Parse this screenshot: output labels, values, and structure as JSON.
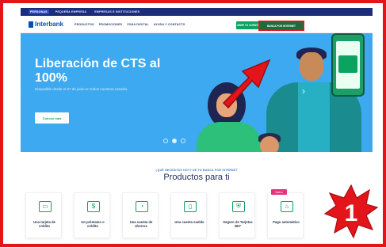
{
  "topbar": {
    "items": [
      "PERSONAS",
      "PEQUEÑA EMPRESA",
      "EMPRESAS E INSTITUCIONES"
    ]
  },
  "nav": {
    "brand": "Interbank",
    "links": [
      "PRODUCTOS",
      "PROMOCIONES",
      "ZONA DIGITAL",
      "AYUDA Y CONTACTO"
    ],
    "open_account_button": "ABRE TU CUENTA",
    "online_banking_button": "BANCA POR INTERNET"
  },
  "hero": {
    "title": "Liberación de CTS al 100%",
    "subtitle": "Disponible desde el 07 de junio en todos nuestros canales.",
    "cta": "Conoce más",
    "prev_arrow": "‹",
    "next_arrow": "›",
    "slide_count": 3,
    "active_slide": 2
  },
  "products": {
    "kicker": "¿QUÉ NECESITAS HOY? DE TU BANCA POR INTERNET",
    "title": "Productos para ti",
    "cards": [
      {
        "label": "Una tarjeta de crédito",
        "icon": "credit-card-icon",
        "glyph": "▭"
      },
      {
        "label": "Un préstamo o crédito",
        "icon": "money-bag-icon",
        "glyph": "$"
      },
      {
        "label": "Una cuenta de ahorros",
        "icon": "piggy-bank-icon",
        "glyph": "◔"
      },
      {
        "label": "Una cuenta sueldo",
        "icon": "mobile-pay-icon",
        "glyph": "▯"
      },
      {
        "label": "Seguro de Tarjetas 360°",
        "icon": "shield-card-icon",
        "glyph": "⛨"
      },
      {
        "label": "Pago automático",
        "icon": "house-icon",
        "glyph": "⌂",
        "badge": "Nuevo"
      }
    ]
  },
  "annotation": {
    "step_number": "1"
  },
  "colors": {
    "brand_blue": "#0a4fb0",
    "hero_bg": "#3da9f0",
    "green": "#0ba360",
    "annotation_red": "#e3151b"
  }
}
